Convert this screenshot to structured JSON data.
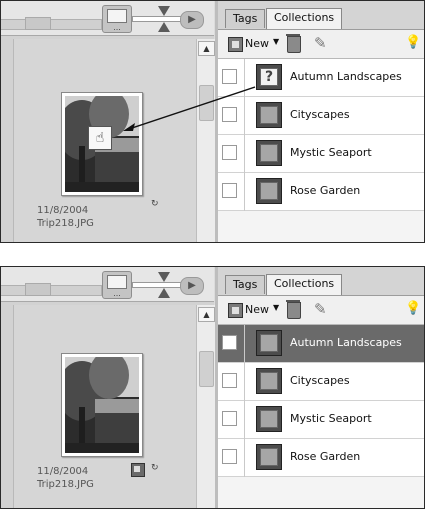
{
  "panels": [
    {
      "state": "dragging",
      "photo": {
        "date": "11/8/2004",
        "filename": "Trip218.JPG"
      },
      "tabs": [
        "Tags",
        "Collections"
      ],
      "toolbar": {
        "new_label": "New"
      },
      "collections": [
        {
          "label": "Autumn Landscapes",
          "icon": "question-icon",
          "selected": false
        },
        {
          "label": "Cityscapes",
          "icon": "collection-icon",
          "selected": false
        },
        {
          "label": "Mystic Seaport",
          "icon": "collection-icon",
          "selected": false
        },
        {
          "label": "Rose Garden",
          "icon": "collection-icon",
          "selected": false
        }
      ]
    },
    {
      "state": "dropped",
      "photo": {
        "date": "11/8/2004",
        "filename": "Trip218.JPG"
      },
      "tabs": [
        "Tags",
        "Collections"
      ],
      "toolbar": {
        "new_label": "New"
      },
      "collections": [
        {
          "label": "Autumn Landscapes",
          "icon": "collection-icon",
          "selected": true
        },
        {
          "label": "Cityscapes",
          "icon": "collection-icon",
          "selected": false
        },
        {
          "label": "Mystic Seaport",
          "icon": "collection-icon",
          "selected": false
        },
        {
          "label": "Rose Garden",
          "icon": "collection-icon",
          "selected": false
        }
      ]
    }
  ],
  "colors": {
    "selected_row": "#6a6a6a",
    "background": "#dcdcdc"
  }
}
